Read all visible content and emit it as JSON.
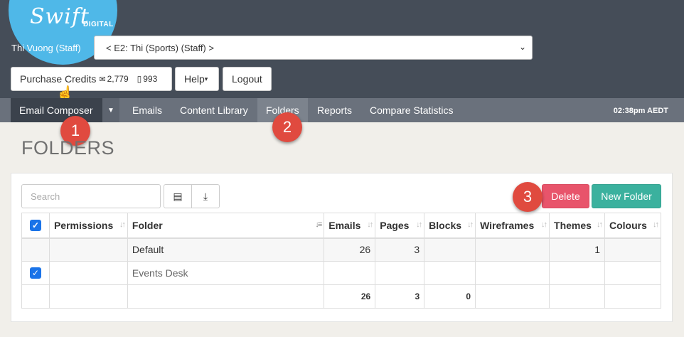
{
  "logo": {
    "script": "Swift",
    "sub": "DIGITAL"
  },
  "header": {
    "user_label": "Thi Vuong (Staff)",
    "account_select": "< E2: Thi (Sports) (Staff) >",
    "purchase_credits_label": "Purchase Credits",
    "email_credits": "2,779",
    "sms_credits": "993",
    "help_label": "Help",
    "logout_label": "Logout"
  },
  "nav": {
    "items": [
      {
        "label": "Email Composer"
      },
      {
        "label": "Emails"
      },
      {
        "label": "Content Library"
      },
      {
        "label": "Folders"
      },
      {
        "label": "Reports"
      },
      {
        "label": "Compare Statistics"
      }
    ],
    "time": "02:38pm AEDT"
  },
  "annotations": [
    "1",
    "2",
    "3"
  ],
  "page": {
    "title": "FOLDERS"
  },
  "toolbar": {
    "search_placeholder": "Search",
    "delete_label": "Delete",
    "new_folder_label": "New Folder"
  },
  "table": {
    "headers": [
      "Permissions",
      "Folder",
      "Emails",
      "Pages",
      "Blocks",
      "Wireframes",
      "Themes",
      "Colours"
    ],
    "rows": [
      {
        "checked": false,
        "permissions": "",
        "folder": "Default",
        "emails": "26",
        "pages": "3",
        "blocks": "",
        "wireframes": "",
        "themes": "1",
        "colours": ""
      },
      {
        "checked": true,
        "permissions": "",
        "folder": "Events Desk",
        "emails": "",
        "pages": "",
        "blocks": "",
        "wireframes": "",
        "themes": "",
        "colours": ""
      }
    ],
    "totals": {
      "emails": "26",
      "pages": "3",
      "blocks": "0"
    }
  },
  "icons": [
    "envelope-icon",
    "mobile-icon",
    "caret-down-icon",
    "list-icon",
    "download-icon",
    "sort-icon",
    "checkbox-icon",
    "hand-cursor-icon",
    "chevron-down-icon"
  ],
  "colors": {
    "header": "#454d58",
    "nav": "#6a717c",
    "logo": "#4fb8e8",
    "delete": "#e8546b",
    "new_folder": "#3bb19e",
    "badge": "#e04a3f"
  }
}
